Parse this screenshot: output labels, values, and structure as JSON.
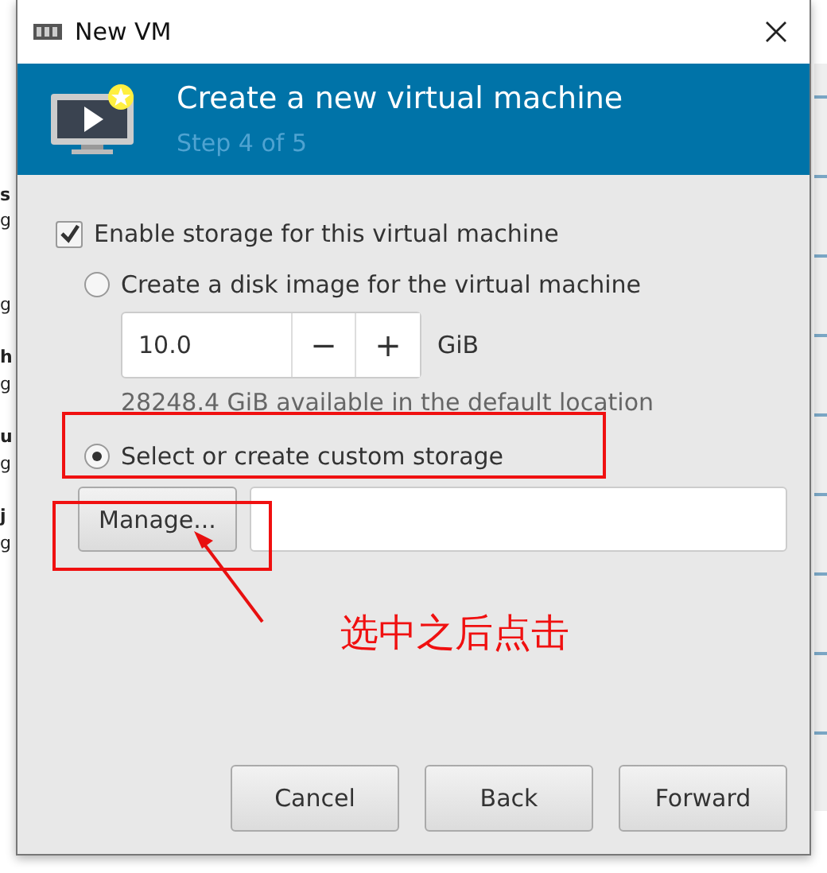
{
  "background_fragments": [
    "s",
    "g",
    "g",
    "h",
    "g",
    "u",
    "g",
    "j",
    "g"
  ],
  "window": {
    "title": "New VM"
  },
  "header": {
    "title": "Create a new virtual machine",
    "step": "Step 4 of 5"
  },
  "enable_storage": {
    "label": "Enable storage for this virtual machine",
    "checked": true
  },
  "storage_options": [
    {
      "kind": "disk",
      "label": "Create a disk image for the virtual machine",
      "selected": false,
      "size": "10.0",
      "minus": "−",
      "plus": "+",
      "unit": "GiB",
      "available": "28248.4 GiB available in the default location"
    },
    {
      "kind": "custom",
      "label": "Select or create custom storage",
      "selected": true,
      "button": "Manage..."
    }
  ],
  "buttons": [
    "Cancel",
    "Back",
    "Forward"
  ],
  "annotation": {
    "text": "选中之后点击"
  }
}
